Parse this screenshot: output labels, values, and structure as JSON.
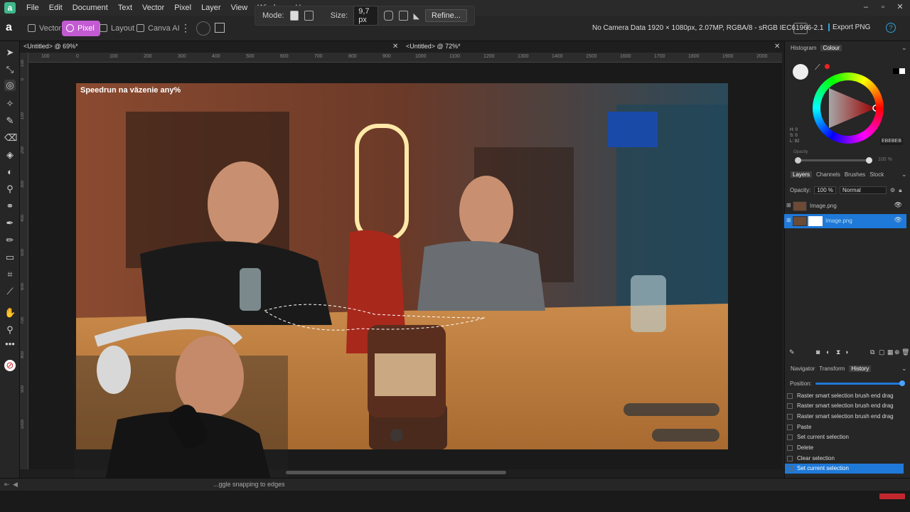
{
  "menu": {
    "items": [
      "File",
      "Edit",
      "Document",
      "Text",
      "Vector",
      "Pixel",
      "Layer",
      "View",
      "Window",
      "He"
    ]
  },
  "context_toolbar": {
    "mode_label": "Mode:",
    "size_label": "Size:",
    "size_value": "9,7 px",
    "refine_label": "Refine..."
  },
  "personas": [
    {
      "label": "Vector",
      "active": false
    },
    {
      "label": "Pixel",
      "active": true
    },
    {
      "label": "Layout",
      "active": false
    },
    {
      "label": "Canva AI",
      "active": false
    }
  ],
  "doc_info": {
    "camera": "No Camera Data",
    "specs": "1920 × 1080px, 2.07MP, RGBA/8 - sRGB IEC61966-2.1",
    "export_label": "Export PNG"
  },
  "tabs": [
    {
      "label": "<Untitled> @ 69%*"
    },
    {
      "label": "<Untitled> @ 72%*"
    }
  ],
  "ruler": {
    "h_ticks": [
      "100",
      "0",
      "100",
      "200",
      "300",
      "400",
      "500",
      "600",
      "700",
      "800",
      "900",
      "1000",
      "1100",
      "1200",
      "1300",
      "1400",
      "1500",
      "1600",
      "1700",
      "1800",
      "1900",
      "2000"
    ],
    "v_ticks": [
      "100",
      "0",
      "100",
      "200",
      "300",
      "400",
      "500",
      "600",
      "700",
      "800",
      "900",
      "1000"
    ]
  },
  "canvas": {
    "video_title": "Speedrun na väzenie any%"
  },
  "status": {
    "text": "...ggle snapping to edges"
  },
  "color_panel": {
    "tabs": [
      "Histogram",
      "Colour"
    ],
    "active_tab": "Colour",
    "h": "H: 0",
    "s": "S: 0",
    "l": "L: 92",
    "hex": "EBEBEB",
    "opacity_label": "Opacity",
    "opacity_value": "100 %"
  },
  "layers_panel": {
    "tabs": [
      "Layers",
      "Channels",
      "Brushes",
      "Stock"
    ],
    "active_tab": "Layers",
    "opacity_label": "Opacity:",
    "opacity_value": "100 %",
    "blend_mode": "Normal",
    "layers": [
      {
        "name": "Image.png",
        "selected": false
      },
      {
        "name": "Image.png",
        "selected": true
      }
    ]
  },
  "history_panel": {
    "tabs": [
      "Navigator",
      "Transform",
      "History"
    ],
    "active_tab": "History",
    "position_label": "Position:",
    "items": [
      {
        "label": "Raster smart selection brush end drag",
        "selected": false
      },
      {
        "label": "Raster smart selection brush end drag",
        "selected": false
      },
      {
        "label": "Raster smart selection brush end drag",
        "selected": false
      },
      {
        "label": "Paste",
        "selected": false
      },
      {
        "label": "Set current selection",
        "selected": false
      },
      {
        "label": "Delete",
        "selected": false
      },
      {
        "label": "Clear selection",
        "selected": false
      },
      {
        "label": "Set current selection",
        "selected": true
      }
    ]
  },
  "colors": {
    "accent": "#1f79d8",
    "pixel_persona": "#c25bd1",
    "export_accent": "#2ea1d8"
  }
}
